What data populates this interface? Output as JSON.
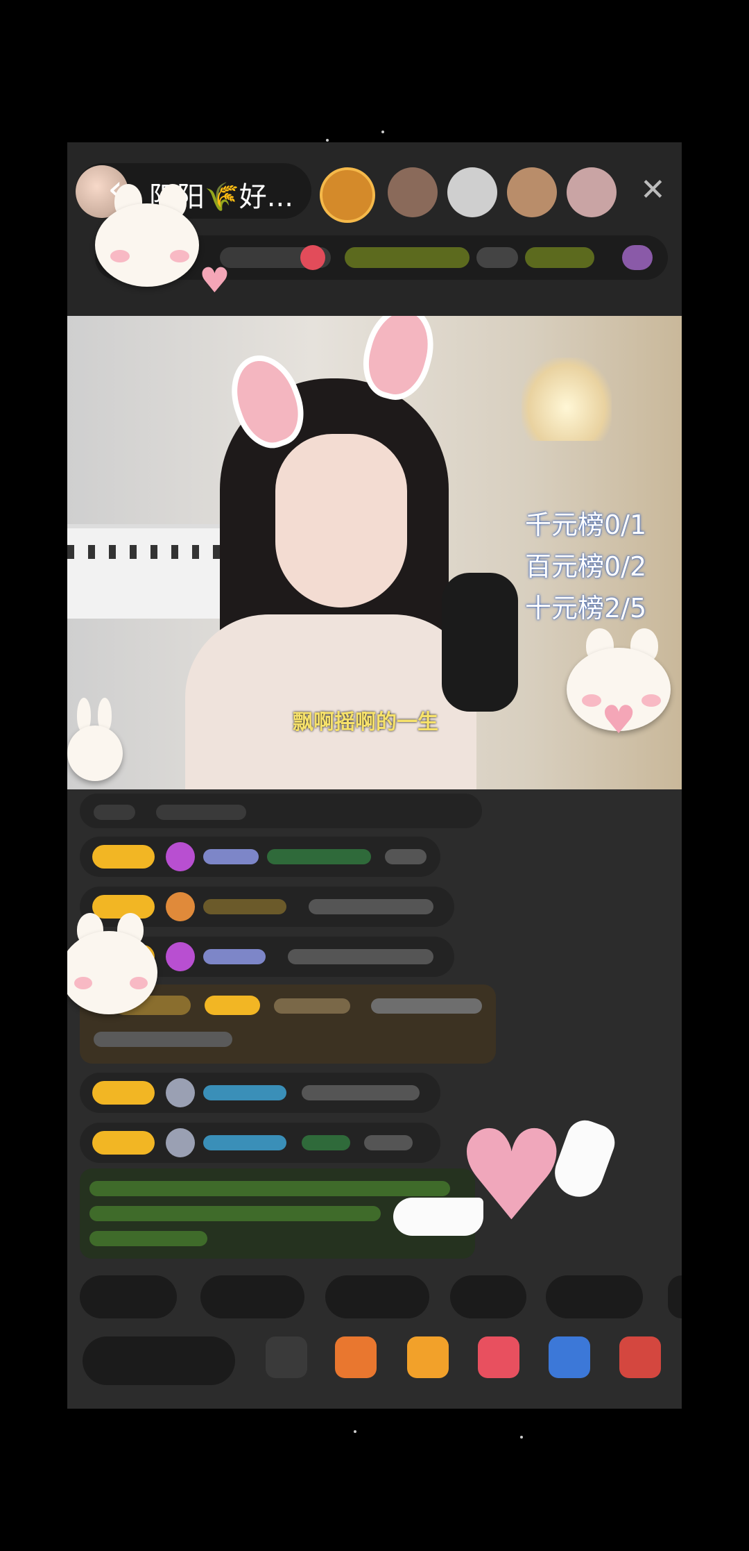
{
  "header": {
    "host_name": "阳阳🌾好...",
    "back_icon": "chevron-left-icon",
    "close_icon": "close-icon"
  },
  "video": {
    "ranking": [
      "千元榜0/1",
      "百元榜0/2",
      "十元榜2/5"
    ],
    "lyric_subtitle": "飘啊摇啊的一生"
  },
  "chat": {
    "badge_color": "#f2b624",
    "accent_pink": "#f4a6b7"
  },
  "toolbar": {
    "icons": [
      "grid-icon",
      "gift-box-icon",
      "fries-icon",
      "heart-gift-icon",
      "game-icon",
      "more-gift-icon"
    ]
  }
}
